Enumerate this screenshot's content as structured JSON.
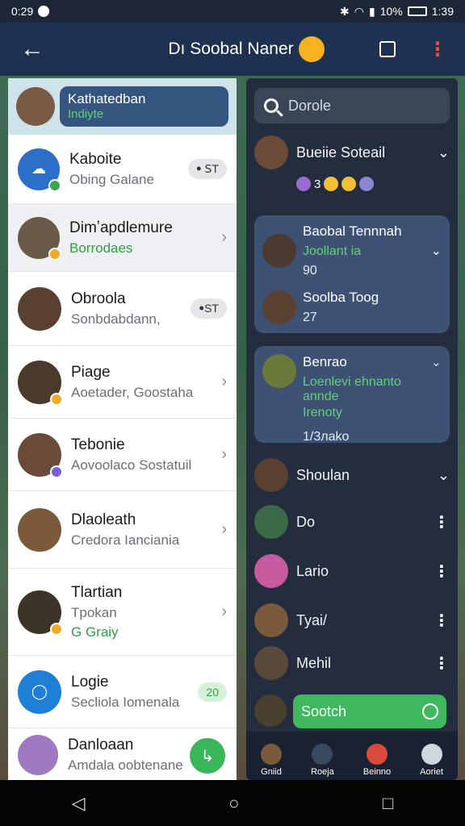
{
  "status": {
    "time": "0:29",
    "battery": "10%",
    "clock": "1:39"
  },
  "appbar": {
    "title": "Dı Soobal Naner",
    "back": "←",
    "menu": "⋮"
  },
  "left": {
    "header": {
      "name": "Kathatedban",
      "sub": "Indiyte"
    },
    "contacts": [
      {
        "name": "Kaboite",
        "sub": "Obing Galane",
        "chip": "ꔷ ꓢT",
        "color": "#2b6fc9"
      },
      {
        "name": "Dimʼapdlemure",
        "sub": "Borrodaes",
        "chev": "›",
        "color": "#6a5b48"
      },
      {
        "name": "Obroola",
        "sub": "Sonbdabdann,",
        "chip": "ꔷST",
        "color": "#5a4030"
      },
      {
        "name": "Piage",
        "sub": "Aoetader, Goostaha",
        "chev": "›",
        "color": "#4a3a2c"
      },
      {
        "name": "Tebonie",
        "sub": "Aovoolaco Sostatuil",
        "chev": "›",
        "color": "#6a4b38"
      },
      {
        "name": "Dlaoleath",
        "sub": "Credora Ianciania",
        "chev": "›",
        "color": "#7a5a3a"
      },
      {
        "name": "Tlartian",
        "sub": "Tpokan",
        "sub2": "G Graiy",
        "chev": "›",
        "color": "#3d3328"
      },
      {
        "name": "Logie",
        "sub": "Secliola Iomenala",
        "chip2": "20",
        "color": "#1d7fd6"
      },
      {
        "name": "Danloaan",
        "sub": "Amdala oobtenane",
        "color": "#a07ac0"
      }
    ]
  },
  "right": {
    "search": "Dorole",
    "items": [
      {
        "name": "Bueiie Soteail",
        "emojis": "3"
      },
      {
        "card1_name": "Baobal Tennnah",
        "card1_line": "Joollant ia",
        "card1_line2": "90",
        "card1_name2": "Soolba Toog",
        "card1_line3": "27"
      },
      {
        "card2_name": "Benrao",
        "card2_line": "Loenlevi ehnanto annde",
        "card2_line2": "Irenoty",
        "card2_line3": "1/3лаko"
      },
      {
        "name": "Shoulan"
      },
      {
        "name": "Do"
      },
      {
        "name": "Lario"
      },
      {
        "name": "Tyai/"
      },
      {
        "name": "Mehil"
      }
    ],
    "button": "Sootch",
    "tabs": [
      "Gniid",
      "Roeja",
      "Beinno",
      "Aoriet"
    ]
  }
}
